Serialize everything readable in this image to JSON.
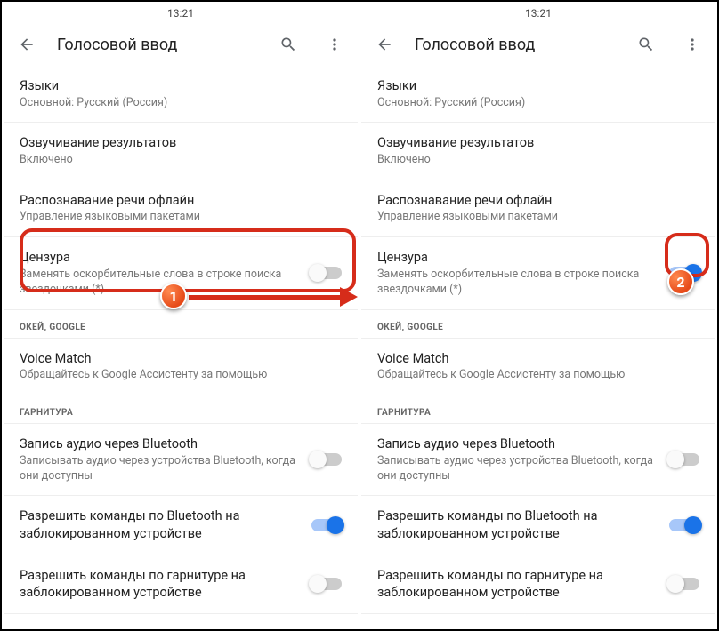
{
  "status": {
    "time": "13:21"
  },
  "header": {
    "title": "Голосовой ввод"
  },
  "languages": {
    "title": "Языки",
    "sub": "Основной: Русский (Россия)"
  },
  "speak": {
    "title": "Озвучивание результатов",
    "sub": "Включено"
  },
  "offline": {
    "title": "Распознавание речи офлайн",
    "sub": "Управление языковыми пакетами"
  },
  "censor": {
    "title": "Цензура",
    "sub": "Заменять оскорбительные слова в строке поиска звездочками (*)"
  },
  "section_ok": "ОКЕЙ, GOOGLE",
  "voicematch": {
    "title": "Voice Match",
    "sub": "Обращайтесь к Google Ассистенту за помощью"
  },
  "section_head": "ГАРНИТУРА",
  "btrec": {
    "title": "Запись аудио через Bluetooth",
    "sub": "Записывать аудио через устройства Bluetooth, когда они доступны"
  },
  "btlock": {
    "title": "Разрешить команды по Bluetooth на заблокированном устройстве"
  },
  "headlock": {
    "title": "Разрешить команды по гарнитуре на заблокированном устройстве"
  },
  "annotations": {
    "badge1": "1",
    "badge2": "2"
  }
}
